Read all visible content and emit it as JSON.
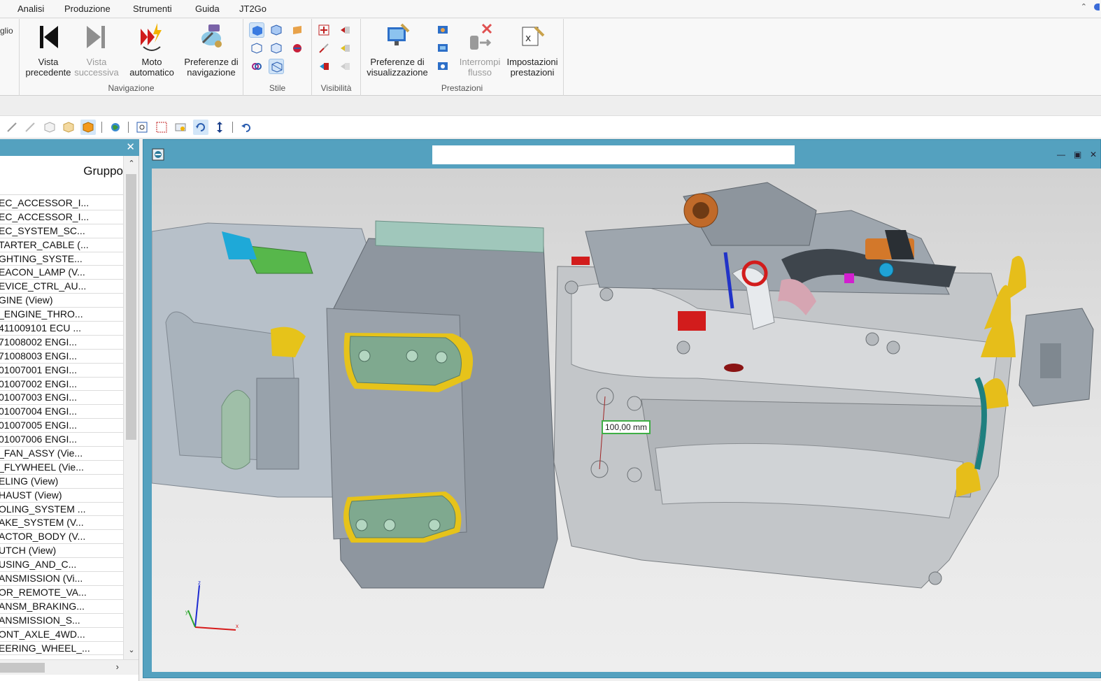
{
  "menu": [
    "Analisi",
    "Produzione",
    "Strumenti",
    "Guida",
    "JT2Go"
  ],
  "ribbon": {
    "lead_fragment": "glio",
    "navigation": {
      "label": "Navigazione",
      "buttons": [
        {
          "line1": "Vista",
          "line2": "precedente"
        },
        {
          "line1": "Vista",
          "line2": "successiva"
        },
        {
          "line1": "Moto",
          "line2": "automatico"
        },
        {
          "line1": "Preferenze di",
          "line2": "navigazione"
        }
      ]
    },
    "style": {
      "label": "Stile"
    },
    "visibility": {
      "label": "Visibilità"
    },
    "performance": {
      "label": "Prestazioni",
      "buttons": [
        {
          "line1": "Preferenze di",
          "line2": "visualizzazione"
        },
        {
          "line1": "Interrompi",
          "line2": "flusso"
        },
        {
          "line1": "Impostazioni",
          "line2": "prestazioni"
        }
      ]
    }
  },
  "panel": {
    "close": "✕",
    "column_header": "Gruppo",
    "items": [
      "EC_ACCESSOR_I...",
      "EC_ACCESSOR_I...",
      "EC_SYSTEM_SC...",
      "TARTER_CABLE (...",
      "GHTING_SYSTE...",
      "EACON_LAMP (V...",
      "EVICE_CTRL_AU...",
      "GINE (View)",
      "_ENGINE_THRO...",
      "411009101 ECU ...",
      "71008002 ENGI...",
      "71008003 ENGI...",
      "01007001 ENGI...",
      "01007002 ENGI...",
      "01007003 ENGI...",
      "01007004 ENGI...",
      "01007005 ENGI...",
      "01007006 ENGI...",
      "_FAN_ASSY (Vie...",
      "_FLYWHEEL (Vie...",
      "ELING (View)",
      "HAUST (View)",
      "OLING_SYSTEM ...",
      "AKE_SYSTEM (V...",
      "ACTOR_BODY (V...",
      "UTCH (View)",
      "USING_AND_C...",
      "ANSMISSION (Vi...",
      "OR_REMOTE_VA...",
      "ANSM_BRAKING...",
      "ANSMISSION_S...",
      "ONT_AXLE_4WD...",
      "EERING_WHEEL_..."
    ]
  },
  "viewer": {
    "measurement": "100,00 mm",
    "axis_labels": {
      "z": "z",
      "y": "y",
      "x": "x"
    }
  },
  "colors": {
    "viewer_frame": "#54a1bf",
    "panel_title": "#54a1bf",
    "measure_border": "#3fae45",
    "engine_silver": "#b9bcbf",
    "bracket_green": "#7fa98f",
    "highlight_yellow": "#e6c31a"
  }
}
